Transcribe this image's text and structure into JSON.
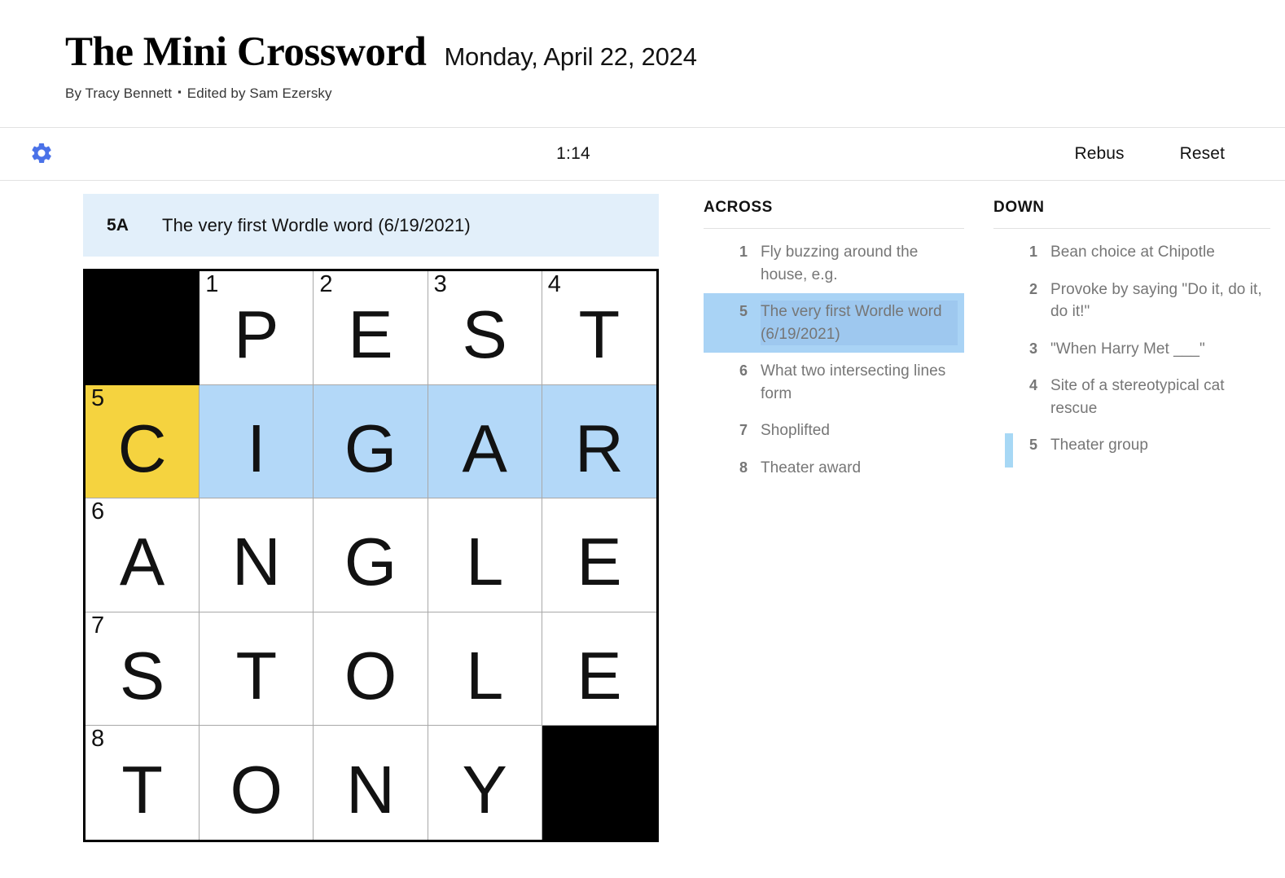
{
  "header": {
    "title": "The Mini Crossword",
    "date": "Monday, April 22, 2024",
    "author": "By Tracy Bennett",
    "separator": "▪",
    "editor": "Edited by Sam Ezersky"
  },
  "toolbar": {
    "settings_icon": "gear-icon",
    "settings_color": "#4a72e8",
    "timer": "1:14",
    "rebus_label": "Rebus",
    "reset_label": "Reset"
  },
  "current_clue": {
    "label": "5A",
    "text": "The very first Wordle word (6/19/2021)",
    "background": "#e2effa"
  },
  "grid": {
    "size": 5,
    "colors": {
      "block": "#000000",
      "highlight": "#b3d8f8",
      "cursor": "#f5d33f",
      "cell": "#ffffff"
    },
    "cells": [
      {
        "type": "block"
      },
      {
        "type": "letter",
        "number": "1",
        "letter": "P"
      },
      {
        "type": "letter",
        "number": "2",
        "letter": "E"
      },
      {
        "type": "letter",
        "number": "3",
        "letter": "S"
      },
      {
        "type": "letter",
        "number": "4",
        "letter": "T"
      },
      {
        "type": "letter",
        "number": "5",
        "letter": "C",
        "state": "cursor"
      },
      {
        "type": "letter",
        "letter": "I",
        "state": "highlight"
      },
      {
        "type": "letter",
        "letter": "G",
        "state": "highlight"
      },
      {
        "type": "letter",
        "letter": "A",
        "state": "highlight"
      },
      {
        "type": "letter",
        "letter": "R",
        "state": "highlight"
      },
      {
        "type": "letter",
        "number": "6",
        "letter": "A"
      },
      {
        "type": "letter",
        "letter": "N"
      },
      {
        "type": "letter",
        "letter": "G"
      },
      {
        "type": "letter",
        "letter": "L"
      },
      {
        "type": "letter",
        "letter": "E"
      },
      {
        "type": "letter",
        "number": "7",
        "letter": "S"
      },
      {
        "type": "letter",
        "letter": "T"
      },
      {
        "type": "letter",
        "letter": "O"
      },
      {
        "type": "letter",
        "letter": "L"
      },
      {
        "type": "letter",
        "letter": "E"
      },
      {
        "type": "letter",
        "number": "8",
        "letter": "T"
      },
      {
        "type": "letter",
        "letter": "O"
      },
      {
        "type": "letter",
        "letter": "N"
      },
      {
        "type": "letter",
        "letter": "Y"
      },
      {
        "type": "block"
      }
    ]
  },
  "clues": {
    "across": {
      "heading": "ACROSS",
      "items": [
        {
          "number": "1",
          "text": "Fly buzzing around the house, e.g."
        },
        {
          "number": "5",
          "text": "The very first Wordle word (6/19/2021)",
          "state": "selected"
        },
        {
          "number": "6",
          "text": "What two intersecting lines form"
        },
        {
          "number": "7",
          "text": "Shoplifted"
        },
        {
          "number": "8",
          "text": "Theater award"
        }
      ]
    },
    "down": {
      "heading": "DOWN",
      "items": [
        {
          "number": "1",
          "text": "Bean choice at Chipotle"
        },
        {
          "number": "2",
          "text": "Provoke by saying \"Do it, do it, do it!\""
        },
        {
          "number": "3",
          "text": "\"When Harry Met ___\""
        },
        {
          "number": "4",
          "text": "Site of a stereotypical cat rescue"
        },
        {
          "number": "5",
          "text": "Theater group",
          "state": "marked"
        }
      ]
    }
  }
}
